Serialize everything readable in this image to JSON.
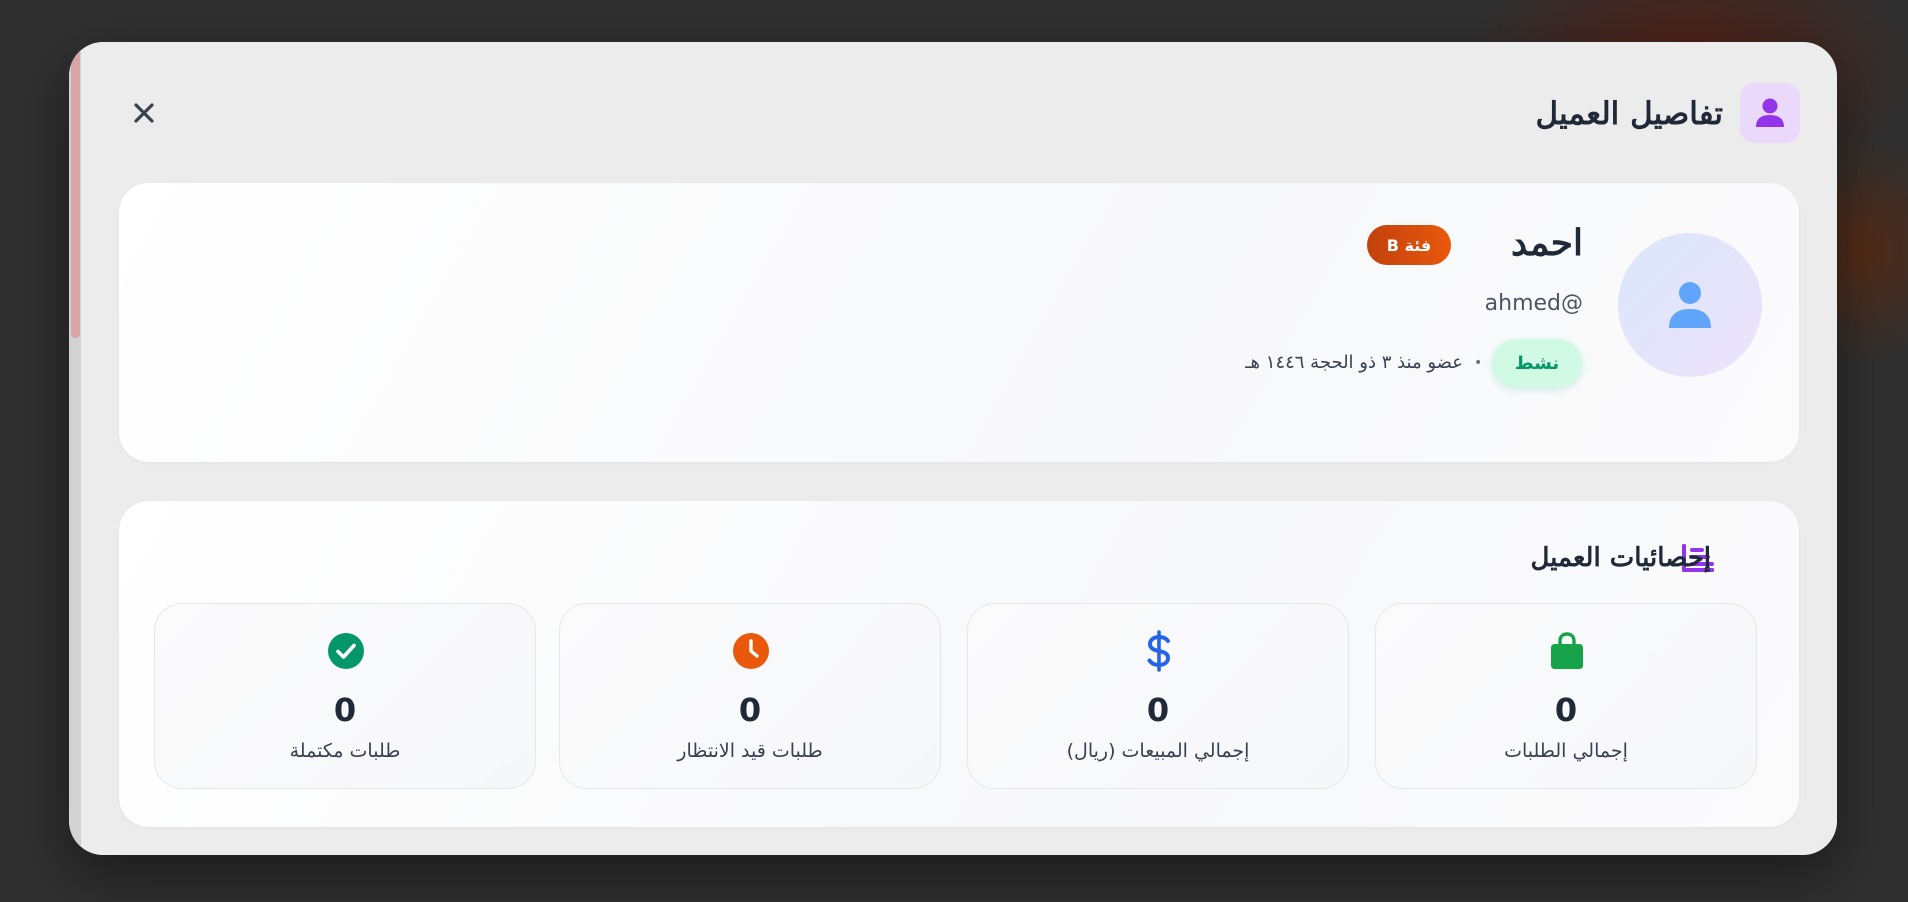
{
  "modal": {
    "title": "تفاصيل العميل",
    "title_icon": "user-icon",
    "close_icon": "close-icon"
  },
  "profile": {
    "name": "احمد",
    "category": "فئة B",
    "username": "ahmed@",
    "status": "نشط",
    "separator": "•",
    "member_since": "عضو منذ ٣ ذو الحجة ١٤٤٦ هـ",
    "avatar_icon": "user-icon"
  },
  "stats": {
    "title": "إحصائيات العميل",
    "title_icon": "chart-bar-icon",
    "items": [
      {
        "value": "0",
        "label": "إجمالي الطلبات",
        "icon": "shopping-bag-icon",
        "color": "#16a34a"
      },
      {
        "value": "0",
        "label": "إجمالي المبيعات (ريال)",
        "icon": "dollar-icon",
        "color": "#2563eb"
      },
      {
        "value": "0",
        "label": "طلبات قيد الانتظار",
        "icon": "clock-icon",
        "color": "#ea580c"
      },
      {
        "value": "0",
        "label": "طلبات مكتملة",
        "icon": "check-circle-icon",
        "color": "#059669"
      }
    ]
  },
  "colors": {
    "accent_purple": "#9333ea",
    "avatar_blue": "#60a5fa",
    "status_green_bg": "#d1fae5",
    "status_green_text": "#059669",
    "category_orange": "#ea580c"
  }
}
